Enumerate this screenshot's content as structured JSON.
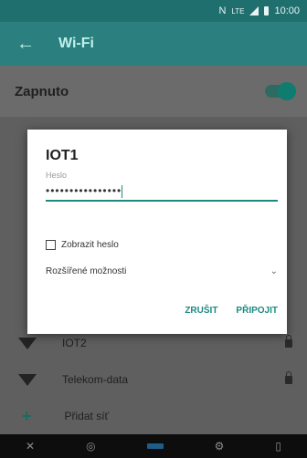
{
  "status_bar": {
    "network": "N",
    "signal_label": "LTE",
    "time": "10:00"
  },
  "app_bar": {
    "title": "Wi-Fi",
    "back_icon": "back-arrow-icon"
  },
  "wifi_toggle": {
    "label": "Zapnuto",
    "state": "on"
  },
  "networks": [
    {
      "name": "IOT2",
      "locked": true
    },
    {
      "name": "Telekom-data",
      "locked": true
    }
  ],
  "add_network": {
    "label": "Přidat síť"
  },
  "dialog": {
    "title": "IOT1",
    "password_hint": "Heslo",
    "password_value": "••••••••••••••••",
    "show_password_label": "Zobrazit heslo",
    "advanced_label": "Rozšířené možnosti",
    "cancel_label": "ZRUŠIT",
    "connect_label": "PŘIPOJIT"
  },
  "colors": {
    "accent": "#1d8a80",
    "appbar": "#2b7f7f"
  }
}
